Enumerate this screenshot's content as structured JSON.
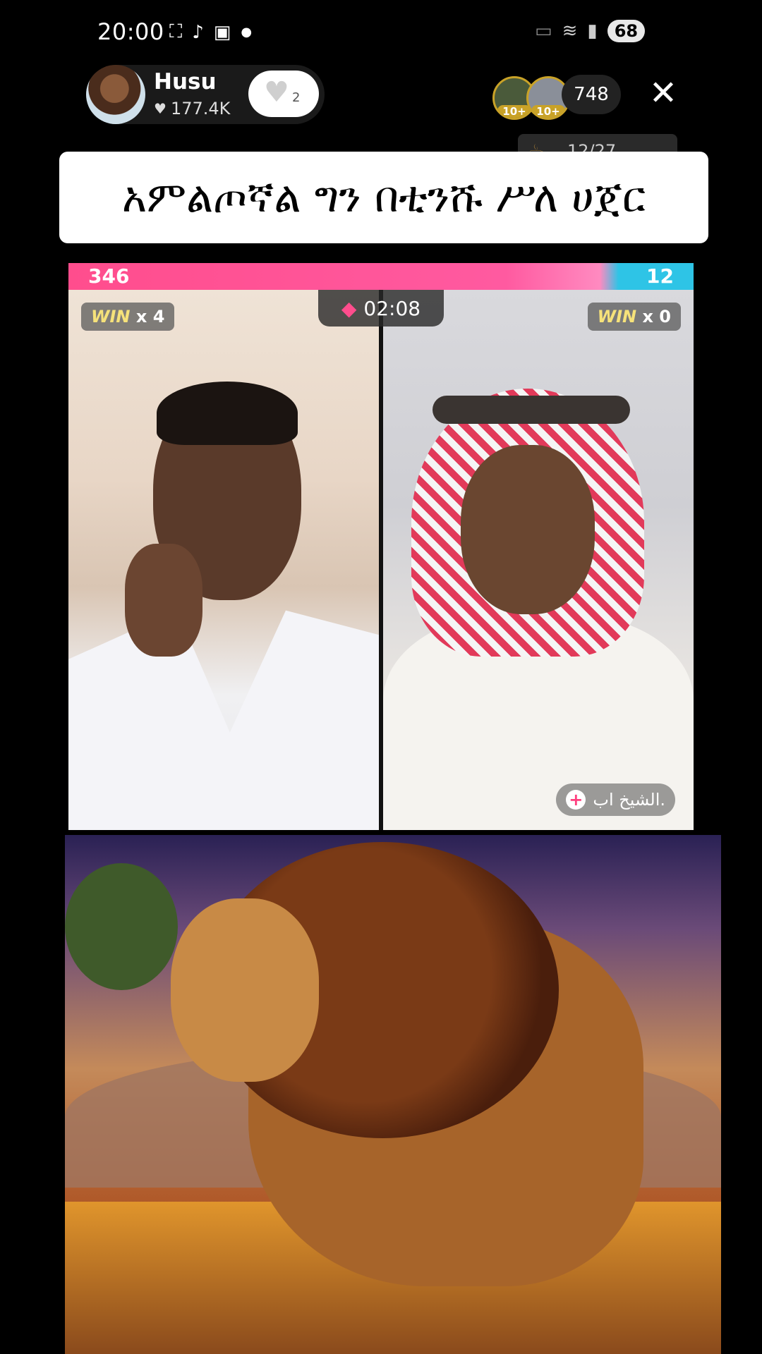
{
  "status_bar": {
    "time": "20:00",
    "left_icons": [
      "screen-record-icon",
      "tiktok-icon",
      "gallery-icon",
      "dot-icon"
    ],
    "right_icons": [
      "cast-icon",
      "wifi-icon",
      "signal-icon"
    ],
    "battery": "68"
  },
  "host": {
    "name": "Husu",
    "likes": "177.4K",
    "follow_count": "2"
  },
  "viewers": {
    "badges": [
      "10+",
      "10+"
    ],
    "count": "748"
  },
  "rank_card": {
    "text": "12/27"
  },
  "caption": {
    "text": "አምልጦኛል ግን በቲንሹ ሥለ ሀጀር"
  },
  "battle": {
    "score_left": "346",
    "score_right": "12",
    "timer": "02:08",
    "win_left": {
      "word": "WIN",
      "count": "x 4"
    },
    "win_right": {
      "word": "WIN",
      "count": "x 0"
    },
    "opponent_name": "الشيخ اب.",
    "colors": {
      "left": "#ff4d8d",
      "right": "#2ec4e6"
    }
  }
}
